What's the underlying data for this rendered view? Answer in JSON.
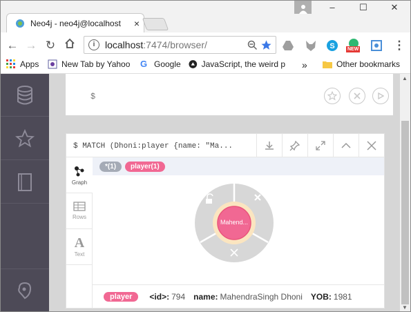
{
  "window": {
    "tab_title": "Neo4j - neo4j@localhost",
    "tab_close": "×",
    "controls": [
      "–",
      "☐",
      "✕"
    ]
  },
  "toolbar": {
    "url_host": "localhost",
    "url_path": ":7474/browser/",
    "badge_new": "NEW"
  },
  "bookmarks": {
    "items": [
      {
        "label": "Apps",
        "icon": "apps-grid-icon"
      },
      {
        "label": "New Tab by Yahoo",
        "icon": "yahoo-icon"
      },
      {
        "label": "Google",
        "icon": "google-icon"
      },
      {
        "label": "JavaScript, the weird p",
        "icon": "js-icon"
      }
    ],
    "overflow": "»",
    "other": "Other bookmarks"
  },
  "editor": {
    "prompt": "$"
  },
  "frame": {
    "query": "$ MATCH (Dhoni:player {name: \"Ma..."
  },
  "views": [
    {
      "label": "Graph",
      "icon": "graph-icon"
    },
    {
      "label": "Rows",
      "icon": "rows-icon"
    },
    {
      "label": "Text",
      "icon": "text-icon"
    }
  ],
  "legend": {
    "all": "*(1)",
    "player": "player(1)"
  },
  "graph": {
    "node_caption": "Mahend...",
    "node_color": "#f16893",
    "ring_color": "#fbe5c0"
  },
  "footer": {
    "label": "player",
    "id_key": "<id>:",
    "id_value": "794",
    "name_key": "name:",
    "name_value": "MahendraSingh Dhoni",
    "yob_key": "YOB:",
    "yob_value": "1981"
  },
  "colors": {
    "sidebar": "#4d4a57",
    "accent_pink": "#f16893",
    "legend_gray": "#a5abb6"
  }
}
